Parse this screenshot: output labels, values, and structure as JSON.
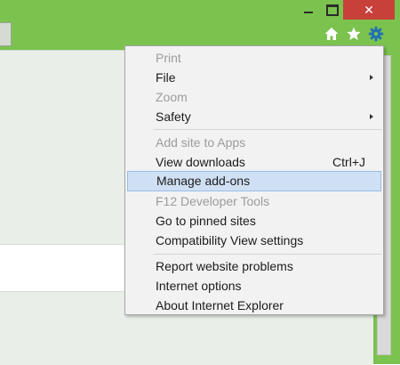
{
  "colors": {
    "frame": "#7bc24f",
    "close_button": "#c7403a",
    "highlight": "#cfe0f4",
    "disabled_text": "#9c9c9c"
  },
  "window_controls": {
    "minimize_icon": "minimize-icon",
    "maximize_icon": "maximize-icon",
    "close_glyph": "✕"
  },
  "toolbar": {
    "icons": [
      "home-icon",
      "star-icon",
      "gear-icon"
    ]
  },
  "menu": {
    "items": [
      {
        "label": "Print",
        "disabled": true,
        "submenu": false
      },
      {
        "label": "File",
        "disabled": false,
        "submenu": true
      },
      {
        "label": "Zoom",
        "disabled": true,
        "submenu": false
      },
      {
        "label": "Safety",
        "disabled": false,
        "submenu": true
      },
      {
        "label": "Add site to Apps",
        "disabled": true,
        "submenu": false
      },
      {
        "label": "View downloads",
        "shortcut": "Ctrl+J",
        "disabled": false,
        "submenu": false
      },
      {
        "label": "Manage add-ons",
        "disabled": false,
        "highlighted": true,
        "submenu": false
      },
      {
        "label": "F12 Developer Tools",
        "disabled": true,
        "submenu": false
      },
      {
        "label": "Go to pinned sites",
        "disabled": false,
        "submenu": false
      },
      {
        "label": "Compatibility View settings",
        "disabled": false,
        "submenu": false
      },
      {
        "label": "Report website problems",
        "disabled": false,
        "submenu": false
      },
      {
        "label": "Internet options",
        "disabled": false,
        "submenu": false
      },
      {
        "label": "About Internet Explorer",
        "disabled": false,
        "submenu": false
      }
    ]
  }
}
